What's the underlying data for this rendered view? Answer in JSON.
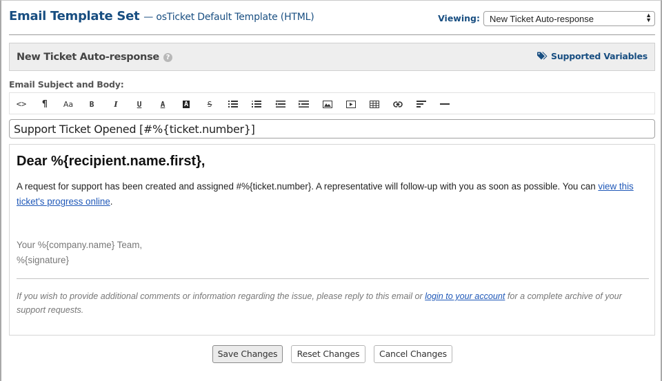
{
  "header": {
    "title": "Email Template Set",
    "subtitle": "— osTicket Default Template (HTML)",
    "viewing_label": "Viewing:",
    "viewing_selected": "New Ticket Auto-response"
  },
  "section": {
    "title": "New Ticket Auto-response",
    "help_icon": "question-circle-icon",
    "supported_variables_label": "Supported Variables",
    "supported_variables_icon": "tags-icon"
  },
  "editor": {
    "label": "Email Subject and Body:",
    "toolbar": [
      {
        "name": "html-source",
        "glyph": "<>"
      },
      {
        "name": "formatting",
        "glyph": "¶"
      },
      {
        "name": "font-size",
        "glyph": "Aa"
      },
      {
        "name": "bold",
        "glyph": "B"
      },
      {
        "name": "italic",
        "glyph": "I"
      },
      {
        "name": "underline",
        "glyph": "U"
      },
      {
        "name": "font-color",
        "glyph": "A"
      },
      {
        "name": "background-color",
        "glyph": "A"
      },
      {
        "name": "strikethrough",
        "glyph": "S"
      },
      {
        "name": "unordered-list",
        "glyph": "ul"
      },
      {
        "name": "ordered-list",
        "glyph": "ol"
      },
      {
        "name": "outdent",
        "glyph": "outdent"
      },
      {
        "name": "indent",
        "glyph": "indent"
      },
      {
        "name": "image",
        "glyph": "image"
      },
      {
        "name": "video",
        "glyph": "video"
      },
      {
        "name": "table",
        "glyph": "table"
      },
      {
        "name": "link",
        "glyph": "link"
      },
      {
        "name": "alignment",
        "glyph": "align"
      },
      {
        "name": "horizontal-rule",
        "glyph": "hr"
      }
    ],
    "subject": "Support Ticket Opened [#%{ticket.number}]",
    "body": {
      "greeting": "Dear %{recipient.name.first},",
      "paragraph_text": "A request for support has been created and assigned #%{ticket.number}. A representative will follow-up with you as soon as possible. You can ",
      "paragraph_link": "view this ticket's progress online",
      "paragraph_end": ".",
      "signature_line1": "Your %{company.name} Team,",
      "signature_line2": "%{signature}",
      "footer_text1": "If you wish to provide additional comments or information regarding the issue, please reply to this email or ",
      "footer_link": "login to your account",
      "footer_text2": " for a complete archive of your support requests."
    }
  },
  "actions": {
    "save": "Save Changes",
    "reset": "Reset Changes",
    "cancel": "Cancel Changes"
  }
}
